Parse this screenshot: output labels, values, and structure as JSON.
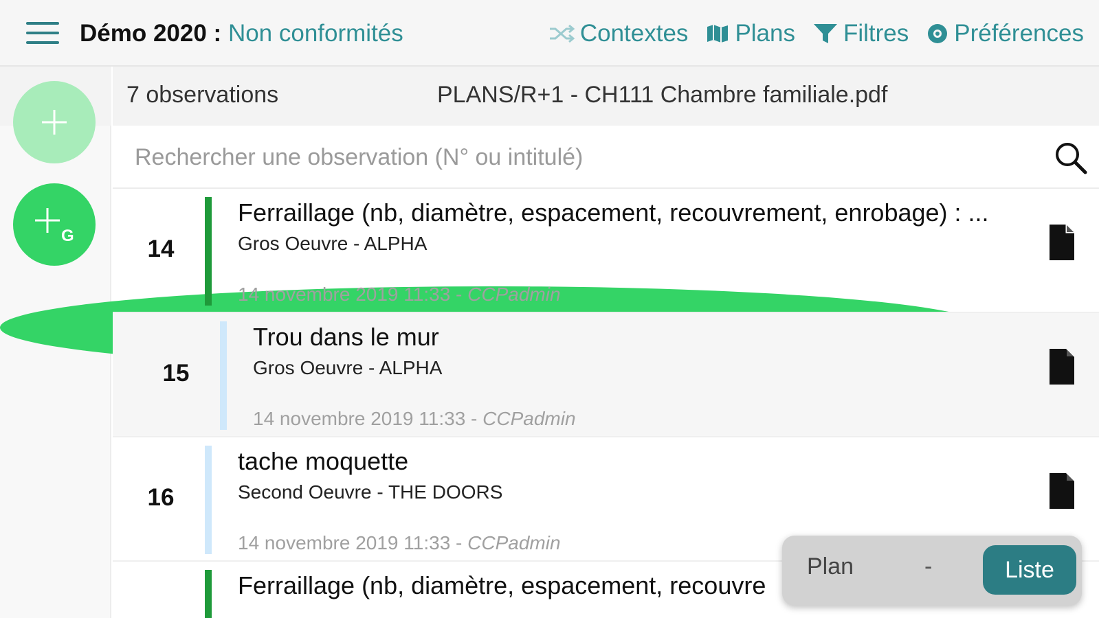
{
  "header": {
    "project": "Démo 2020",
    "separator": " : ",
    "module": "Non conformités",
    "nav": [
      {
        "label": "Contextes",
        "icon": "shuffle-icon"
      },
      {
        "label": "Plans",
        "icon": "map-icon"
      },
      {
        "label": "Filtres",
        "icon": "filter-icon"
      },
      {
        "label": "Préférences",
        "icon": "settings-icon"
      }
    ]
  },
  "rail": {
    "buttons": [
      {
        "icon": "plus-icon",
        "state": "disabled"
      },
      {
        "icon": "plus-g-icon",
        "badge": "G"
      },
      {
        "icon": "list-icon"
      }
    ]
  },
  "info": {
    "count": "7 observations",
    "file": "PLANS/R+1 - CH111 Chambre familiale.pdf"
  },
  "search": {
    "placeholder": "Rechercher une observation (N° ou intitulé)",
    "value": ""
  },
  "observations": [
    {
      "num": "14",
      "title": "Ferraillage (nb, diamètre, espacement, recouvrement, enrobage) : ...",
      "subtitle": "Gros Oeuvre - ALPHA",
      "date": "14 novembre 2019 11:33 - ",
      "user": "CCPadmin",
      "status_color": "#1f9a3a"
    },
    {
      "num": "15",
      "title": "Trou dans le mur",
      "subtitle": "Gros Oeuvre - ALPHA",
      "date": "14 novembre 2019 11:33 - ",
      "user": "CCPadmin",
      "status_color": "#cfe8fb"
    },
    {
      "num": "16",
      "title": "tache moquette",
      "subtitle": "Second Oeuvre - THE DOORS",
      "date": "14 novembre 2019 11:33 - ",
      "user": "CCPadmin",
      "status_color": "#cfe8fb"
    },
    {
      "num": "",
      "title": "Ferraillage (nb, diamètre, espacement, recouvre",
      "subtitle": "",
      "date": "",
      "user": "",
      "status_color": "#1f9a3a"
    }
  ],
  "toggle": {
    "plan": "Plan",
    "separator": "-",
    "liste": "Liste",
    "active": "Liste"
  },
  "colors": {
    "accent": "#2f8f95",
    "fab_green": "#34d466",
    "fab_disabled": "#a8ecba",
    "toggle_active": "#2c7d84"
  }
}
